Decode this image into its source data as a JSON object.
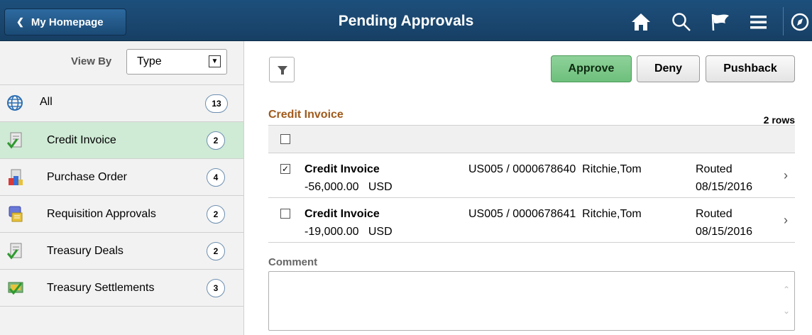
{
  "header": {
    "back_label": "My Homepage",
    "title": "Pending Approvals",
    "icons": [
      "home-icon",
      "search-icon",
      "flag-icon",
      "menu-icon",
      "compass-icon"
    ],
    "colors": {
      "bar": "#1d4f7c"
    }
  },
  "sidebar": {
    "view_by_label": "View By",
    "view_by_value": "Type",
    "items": [
      {
        "label": "All",
        "count": "13",
        "icon": "globe-icon"
      },
      {
        "label": "Credit Invoice",
        "count": "2",
        "icon": "credit-invoice-icon"
      },
      {
        "label": "Purchase Order",
        "count": "4",
        "icon": "purchase-order-icon"
      },
      {
        "label": "Requisition Approvals",
        "count": "2",
        "icon": "requisition-icon"
      },
      {
        "label": "Treasury Deals",
        "count": "2",
        "icon": "treasury-deals-icon"
      },
      {
        "label": "Treasury Settlements",
        "count": "3",
        "icon": "treasury-settlements-icon"
      }
    ],
    "selected_index": 1
  },
  "main": {
    "buttons": {
      "approve": "Approve",
      "deny": "Deny",
      "pushback": "Pushback"
    },
    "section_title": "Credit Invoice",
    "rows_count": "2 rows",
    "rows": [
      {
        "checked": true,
        "title": "Credit Invoice",
        "amount": "-56,000.00   USD",
        "ids": "US005 / 0000678640  Ritchie,Tom",
        "status": "Routed",
        "date": "08/15/2016"
      },
      {
        "checked": false,
        "title": "Credit Invoice",
        "amount": "-19,000.00   USD",
        "ids": "US005 / 0000678641  Ritchie,Tom",
        "status": "Routed",
        "date": "08/15/2016"
      }
    ],
    "comment_label": "Comment",
    "comment_value": ""
  }
}
